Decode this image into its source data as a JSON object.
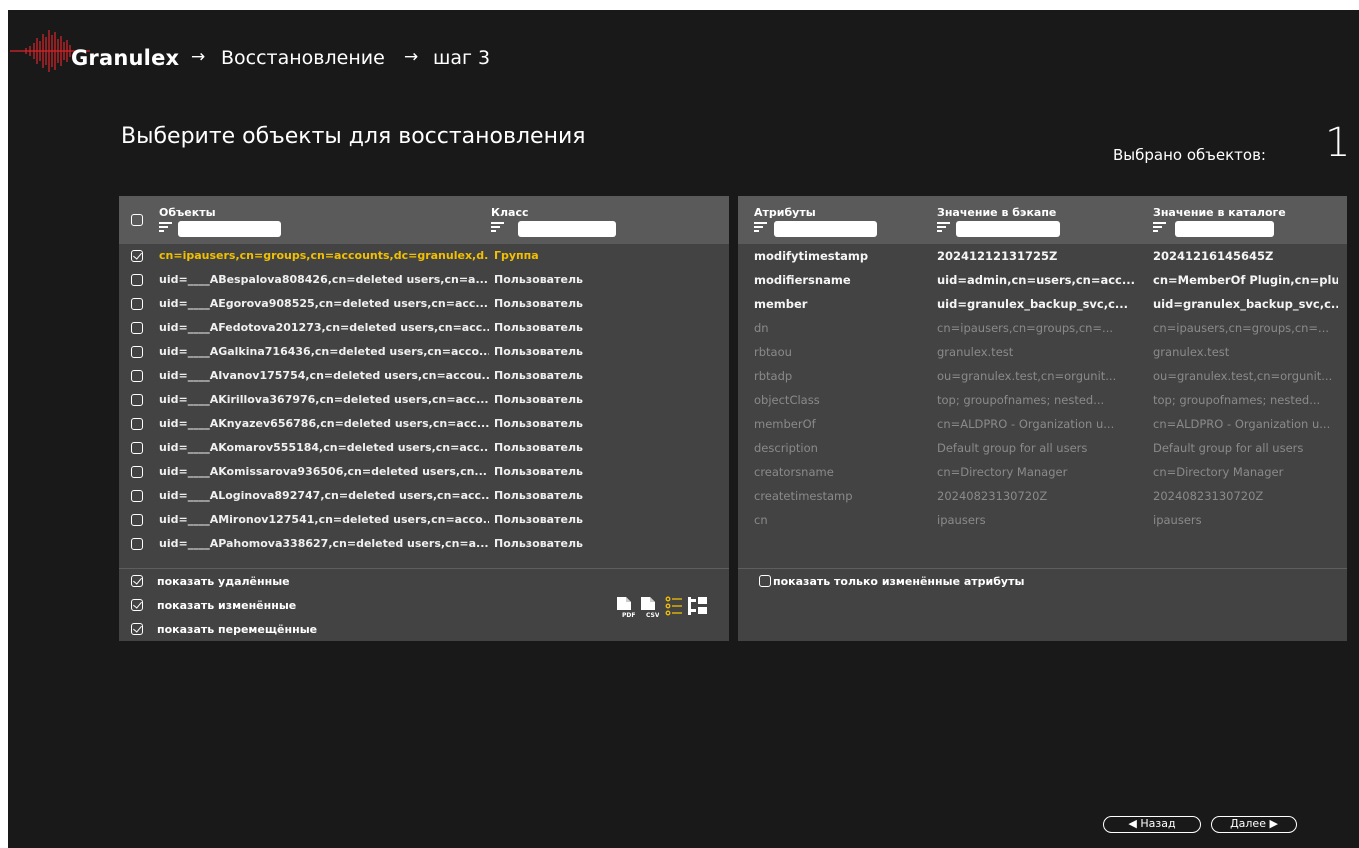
{
  "header": {
    "app_name": "Granulex",
    "crumbs": [
      "Восстановление",
      "шаг 3"
    ],
    "arrow": "→"
  },
  "page": {
    "title": "Выберите объекты для восстановления",
    "selected_label": "Выбрано объектов:",
    "selected_count": "1"
  },
  "objects_table": {
    "columns": [
      "Объекты",
      "Класс"
    ],
    "rows": [
      {
        "object": "cn=ipausers,cn=groups,cn=accounts,dc=granulex,d...",
        "class": "Группа",
        "checked": true
      },
      {
        "object": "uid=____ABespalova808426,cn=deleted users,cn=a...",
        "class": "Пользователь",
        "checked": false
      },
      {
        "object": "uid=____AEgorova908525,cn=deleted users,cn=acc...",
        "class": "Пользователь",
        "checked": false
      },
      {
        "object": "uid=____AFedotova201273,cn=deleted users,cn=acc...",
        "class": "Пользователь",
        "checked": false
      },
      {
        "object": "uid=____AGalkina716436,cn=deleted users,cn=acco...",
        "class": "Пользователь",
        "checked": false
      },
      {
        "object": "uid=____AIvanov175754,cn=deleted users,cn=accou...",
        "class": "Пользователь",
        "checked": false
      },
      {
        "object": "uid=____AKirillova367976,cn=deleted users,cn=acc...",
        "class": "Пользователь",
        "checked": false
      },
      {
        "object": "uid=____AKnyazev656786,cn=deleted users,cn=acc...",
        "class": "Пользователь",
        "checked": false
      },
      {
        "object": "uid=____AKomarov555184,cn=deleted users,cn=acc...",
        "class": "Пользователь",
        "checked": false
      },
      {
        "object": "uid=____AKomissarova936506,cn=deleted users,cn...",
        "class": "Пользователь",
        "checked": false
      },
      {
        "object": "uid=____ALoginova892747,cn=deleted users,cn=acc...",
        "class": "Пользователь",
        "checked": false
      },
      {
        "object": "uid=____AMironov127541,cn=deleted users,cn=acco...",
        "class": "Пользователь",
        "checked": false
      },
      {
        "object": "uid=____APahomova338627,cn=deleted users,cn=a...",
        "class": "Пользователь",
        "checked": false
      }
    ],
    "options": [
      {
        "label": "показать удалённые",
        "checked": true
      },
      {
        "label": "показать изменённые",
        "checked": true
      },
      {
        "label": "показать перемещённые",
        "checked": true
      }
    ],
    "tools": [
      "pdf-export-icon",
      "csv-export-icon",
      "list-view-icon",
      "tree-view-icon"
    ]
  },
  "attributes_table": {
    "columns": [
      "Атрибуты",
      "Значение в бэкапе",
      "Значение в каталоге"
    ],
    "rows": [
      {
        "attr": "modifytimestamp",
        "backup": "20241212131725Z",
        "catalog": "20241216145645Z",
        "changed": true
      },
      {
        "attr": "modifiersname",
        "backup": "uid=admin,cn=users,cn=acc...",
        "catalog": "cn=MemberOf Plugin,cn=plu...",
        "changed": true
      },
      {
        "attr": "member",
        "backup": "uid=granulex_backup_svc,c...",
        "catalog": "uid=granulex_backup_svc,c...",
        "changed": true
      },
      {
        "attr": "dn",
        "backup": "cn=ipausers,cn=groups,cn=...",
        "catalog": "cn=ipausers,cn=groups,cn=...",
        "changed": false
      },
      {
        "attr": "rbtaou",
        "backup": "granulex.test",
        "catalog": "granulex.test",
        "changed": false
      },
      {
        "attr": "rbtadp",
        "backup": "ou=granulex.test,cn=orgunit...",
        "catalog": "ou=granulex.test,cn=orgunit...",
        "changed": false
      },
      {
        "attr": "objectClass",
        "backup": "top; groupofnames; nested...",
        "catalog": "top; groupofnames; nested...",
        "changed": false
      },
      {
        "attr": "memberOf",
        "backup": "cn=ALDPRO - Organization u...",
        "catalog": "cn=ALDPRO - Organization u...",
        "changed": false
      },
      {
        "attr": "description",
        "backup": "Default group for all users",
        "catalog": "Default group for all users",
        "changed": false
      },
      {
        "attr": "creatorsname",
        "backup": "cn=Directory Manager",
        "catalog": "cn=Directory Manager",
        "changed": false
      },
      {
        "attr": "createtimestamp",
        "backup": "20240823130720Z",
        "catalog": "20240823130720Z",
        "changed": false
      },
      {
        "attr": "cn",
        "backup": "ipausers",
        "catalog": "ipausers",
        "changed": false
      }
    ],
    "option": {
      "label": "показать только изменённые атрибуты",
      "checked": false
    }
  },
  "footer": {
    "back_label": "Назад",
    "next_label": "Далее"
  },
  "colors": {
    "background": "#191919",
    "panel": "#434343",
    "panel_header": "#5a5a5a",
    "highlight": "#f2c000"
  }
}
